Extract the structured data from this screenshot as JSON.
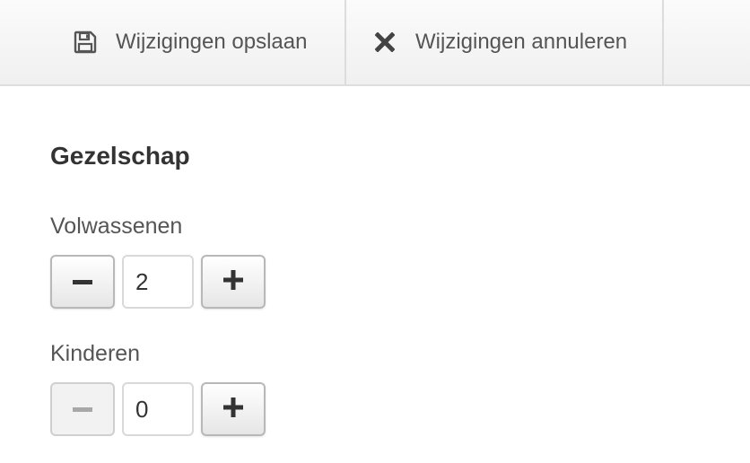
{
  "toolbar": {
    "save_label": "Wijzigingen opslaan",
    "save_icon": "floppy-disk-icon",
    "cancel_label": "Wijzigingen annuleren",
    "cancel_icon": "x-icon"
  },
  "section": {
    "title": "Gezelschap"
  },
  "adults": {
    "label": "Volwassenen",
    "value": "2",
    "minus_enabled": true,
    "plus_enabled": true
  },
  "children": {
    "label": "Kinderen",
    "value": "0",
    "minus_enabled": false,
    "plus_enabled": true
  },
  "colors": {
    "text": "#333333",
    "label_text": "#555555",
    "toolbar_bg": "#f5f5f5",
    "disabled_icon": "#a8a8a8"
  }
}
